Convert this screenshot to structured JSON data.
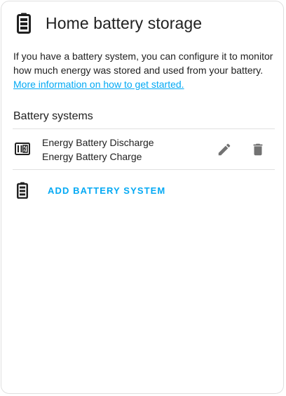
{
  "header": {
    "title": "Home battery storage",
    "icon": "battery-icon"
  },
  "description": {
    "text": "If you have a battery system, you can configure it to monitor how much energy was stored and used from your battery.",
    "link_text": "More information on how to get started."
  },
  "section": {
    "title": "Battery systems"
  },
  "battery_systems": [
    {
      "icon": "battery-charging-icon",
      "discharge": "Energy Battery Discharge",
      "charge": "Energy Battery Charge"
    }
  ],
  "actions": {
    "edit_icon": "pencil-icon",
    "delete_icon": "trash-icon",
    "add_label": "ADD BATTERY SYSTEM",
    "add_icon": "battery-icon"
  },
  "colors": {
    "accent": "#03a9f4",
    "text": "#212121",
    "icon": "#212121",
    "action_icon": "#727272",
    "divider": "#e0e0e0"
  }
}
